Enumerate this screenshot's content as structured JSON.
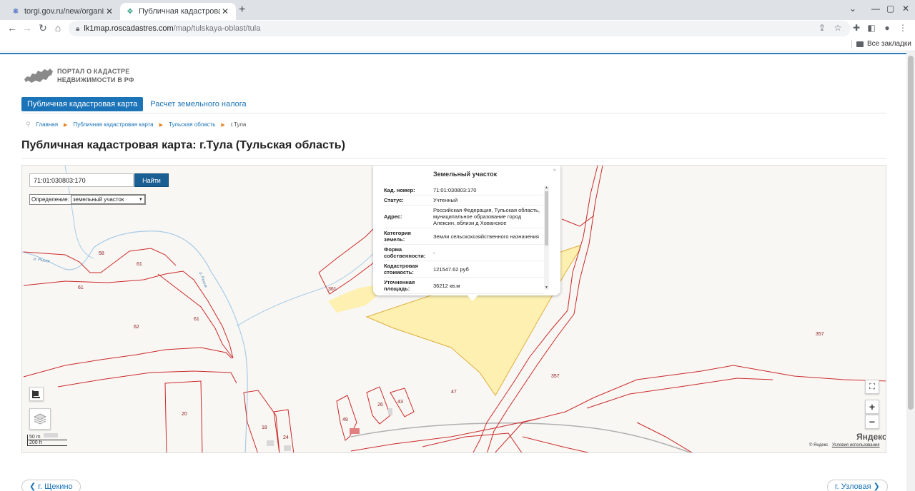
{
  "browser": {
    "tabs": [
      {
        "title": "torgi.gov.ru/new/organizatio",
        "active": false
      },
      {
        "title": "Публичная кадастровая ка",
        "active": true
      }
    ],
    "url_host": "lk1map.roscadastres.com",
    "url_path": "/map/tulskaya-oblast/tula",
    "bookmarks_all": "Все закладки"
  },
  "header": {
    "logo_line1": "ПОРТАЛ О КАДАСТРЕ",
    "logo_line2": "НЕДВИЖИМОСТИ В РФ"
  },
  "nav": {
    "active": "Публичная кадастровая карта",
    "link": "Расчет земельного налога"
  },
  "breadcrumb": [
    "Главная",
    "Публичная кадастровая карта",
    "Тульская область",
    "г.Тула"
  ],
  "page_title": "Публичная кадастровая карта: г.Тула (Тульская область)",
  "map": {
    "search_value": "71:01:030803:170",
    "search_button": "Найти",
    "definition_label": "Определение:",
    "definition_value": "земельный участок",
    "parcel_labels": [
      "58",
      "61",
      "61",
      "61",
      "62",
      "361",
      "357",
      "357",
      "47",
      "20",
      "18",
      "24",
      "49",
      "26",
      "43"
    ],
    "river_labels": [
      "р. Рысня",
      "р. Рысня"
    ],
    "scale_m": "50 m",
    "scale_ft": "200 ft",
    "copyright": "© Яндекс",
    "terms": "Условия использования",
    "yandex_logo": "Яндекс",
    "zoom_in": "+",
    "zoom_out": "−"
  },
  "popup": {
    "title": "Земельный участок",
    "rows": [
      {
        "key": "Кад. номер:",
        "value": "71:01:030803:170"
      },
      {
        "key": "Статус:",
        "value": "Учтенный"
      },
      {
        "key": "Адрес:",
        "value": "Российская Федерация, Тульская область, муниципальное образование город Алексин, вблизи д Хованское"
      },
      {
        "key": "Категория земель:",
        "value": "Земли сельскохозяйственного назначения"
      },
      {
        "key": "Форма собственности:",
        "value": "-"
      },
      {
        "key": "Кадастровая стоимость:",
        "value": "121547.62 руб"
      },
      {
        "key": "Уточненная площадь:",
        "value": "36212 кв.м"
      }
    ]
  },
  "pager": {
    "prev": "г. Щекино",
    "next": "г. Узловая"
  },
  "colors": {
    "accent": "#1b73b8",
    "parcel_border": "#cc2a2a",
    "selected_fill": "#fdf0b0"
  }
}
